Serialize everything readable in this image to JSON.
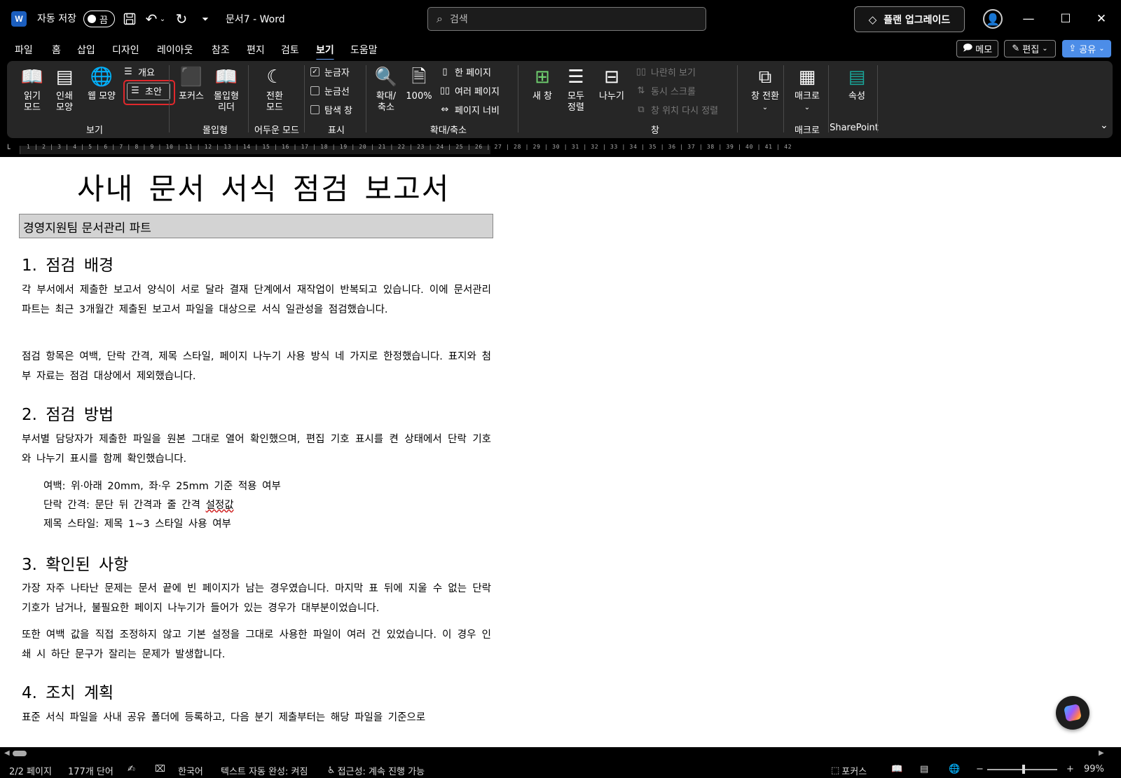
{
  "titlebar": {
    "autosave_label": "자동 저장",
    "autosave_state": "끔",
    "doc_title": "문서7  -  Word",
    "search_placeholder": "검색",
    "upgrade_label": "플랜 업그레이드"
  },
  "menu": {
    "items": [
      "파일",
      "홈",
      "삽입",
      "디자인",
      "레이아웃",
      "참조",
      "편지",
      "검토",
      "보기",
      "도움말"
    ],
    "active": "보기",
    "memo": "메모",
    "edit": "편집",
    "share": "공유"
  },
  "ribbon": {
    "view": {
      "read_mode": [
        "읽기",
        "모드"
      ],
      "print_layout": [
        "인쇄",
        "모양"
      ],
      "web_layout": "웹 모양",
      "outline": "개요",
      "draft": "초안",
      "label": "보기"
    },
    "immersive": {
      "focus": "포커스",
      "reader": [
        "몰입형",
        "리더"
      ],
      "label": "몰입형"
    },
    "dark": {
      "switch": [
        "전환",
        "모드"
      ],
      "label": "어두운 모드"
    },
    "show": {
      "ruler": "눈금자",
      "gridlines": "눈금선",
      "nav_pane": "탐색 창",
      "label": "표시",
      "ruler_checked": true
    },
    "zoom": {
      "zoom": [
        "확대/",
        "축소"
      ],
      "hundred": "100%",
      "one_page": "한 페이지",
      "multi_page": "여러 페이지",
      "page_width": "페이지 너비",
      "label": "확대/축소"
    },
    "window": {
      "new_window": "새 창",
      "arrange_all": [
        "모두",
        "정렬"
      ],
      "split": "나누기",
      "side_by_side": "나란히 보기",
      "sync_scroll": "동시 스크롤",
      "reset_pos": "창 위치 다시 정렬",
      "switch_windows": "창 전환",
      "label": "창"
    },
    "macros": {
      "macro": "매크로",
      "label": "매크로"
    },
    "sharepoint": {
      "properties": "속성",
      "label": "SharePoint"
    }
  },
  "ruler": {
    "text": "1 | 2 | 3 | 4 | 5 | 6 | 7 | 8 | 9 | 10 | 11 | 12 | 13 | 14 | 15 | 16 | 17 | 18 | 19 | 20 | 21 | 22 | 23 | 24 | 25 | 26 | 27 | 28 | 29 | 30 | 31 | 32 | 33 | 34 | 35 | 36 | 37 | 38 | 39 | 40 | 41 | 42"
  },
  "document": {
    "title": "사내 문서 서식 점검 보고서",
    "department": "경영지원팀 문서관리 파트",
    "sections": [
      {
        "heading": "1. 점검 배경",
        "paragraphs": [
          "각 부서에서 제출한 보고서 양식이 서로 달라 결재 단계에서 재작업이 반복되고 있습니다. 이에 문서관리 파트는 최근 3개월간 제출된 보고서 파일을 대상으로 서식 일관성을 점검했습니다.",
          "점검 항목은 여백, 단락 간격, 제목 스타일, 페이지 나누기 사용 방식 네 가지로 한정했습니다. 표지와 첨부 자료는 점검 대상에서 제외했습니다."
        ]
      },
      {
        "heading": "2. 점검 방법",
        "paragraphs": [
          "부서별 담당자가 제출한 파일을 원본 그대로 열어 확인했으며, 편집 기호 표시를 켠 상태에서 단락 기호와 나누기 표시를 함께 확인했습니다."
        ],
        "list": [
          "여백: 위·아래 20mm, 좌·우 25mm 기준 적용 여부",
          "단락 간격: 문단 뒤 간격과 줄 간격 ",
          "제목 스타일: 제목 1~3 스타일 사용 여부"
        ],
        "list_squiggle_word": "설정값"
      },
      {
        "heading": "3. 확인된 사항",
        "paragraphs": [
          "가장 자주 나타난 문제는 문서 끝에 빈 페이지가 남는 경우였습니다. 마지막 표 뒤에 지울 수 없는 단락 기호가 남거나, 불필요한 페이지 나누기가 들어가 있는 경우가 대부분이었습니다.",
          "또한 여백 값을 직접 조정하지 않고 기본 설정을 그대로 사용한 파일이 여러 건 있었습니다. 이 경우 인쇄 시 하단 문구가 잘리는 문제가 발생합니다."
        ]
      },
      {
        "heading": "4. 조치 계획",
        "paragraphs": [
          "표준 서식 파일을 사내 공유 폴더에 등록하고, 다음 분기 제출부터는 해당 파일을 기준으로"
        ]
      }
    ]
  },
  "status": {
    "page": "2/2 페이지",
    "words": "177개 단어",
    "language": "한국어",
    "autocomplete": "텍스트 자동 완성: 켜짐",
    "accessibility": "접근성: 계속 진행 가능",
    "focus": "포커스",
    "zoom": "99%"
  }
}
